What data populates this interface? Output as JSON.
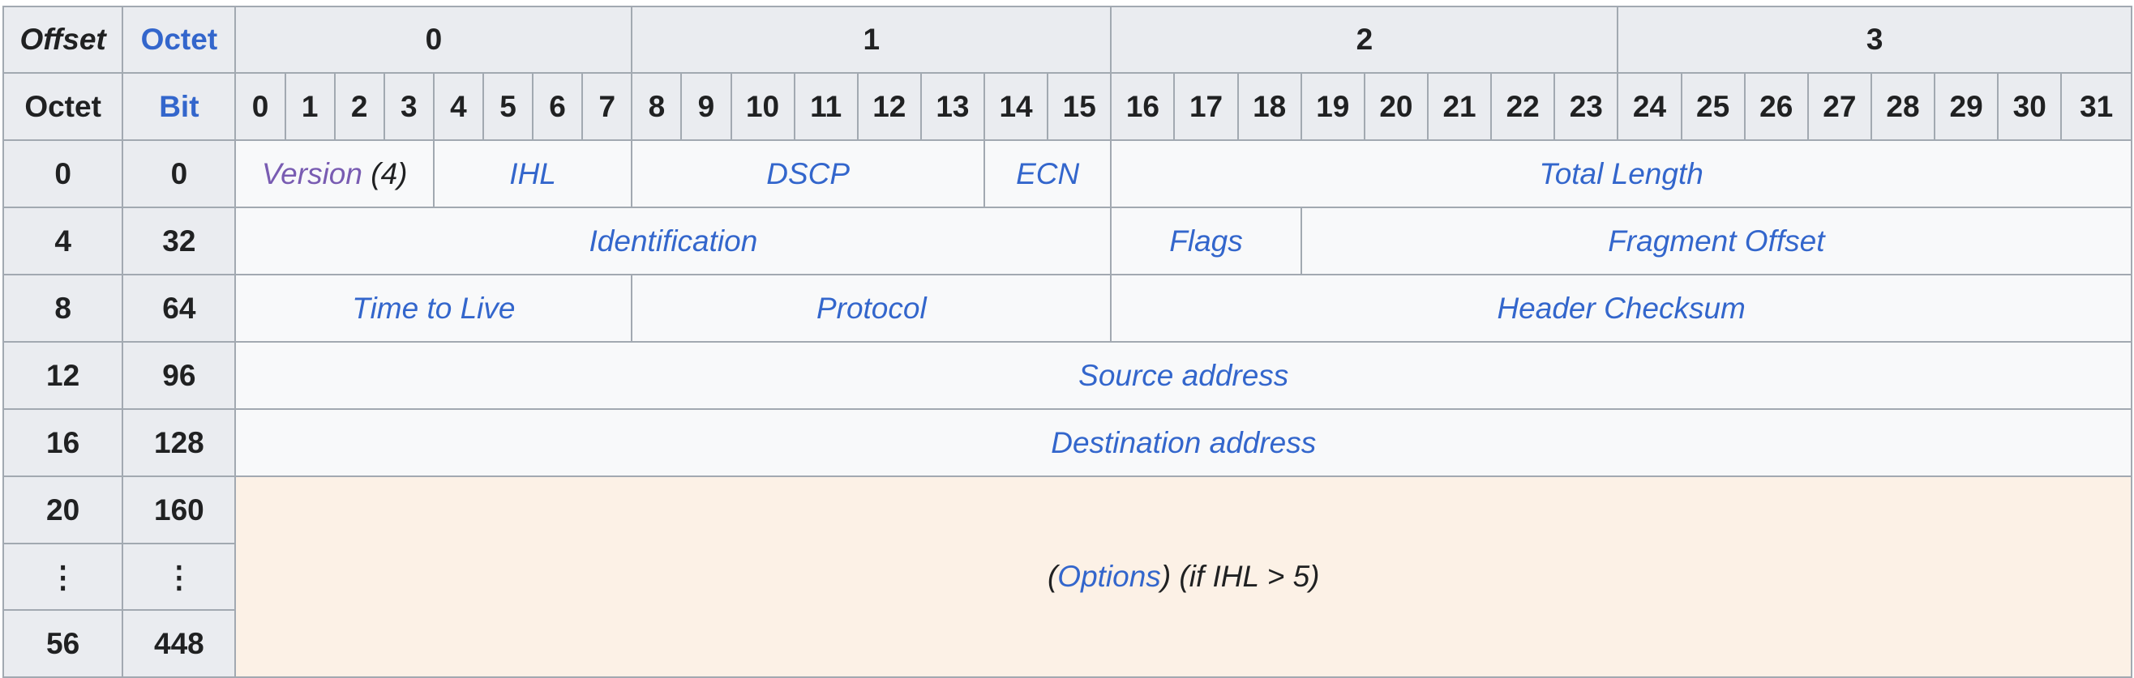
{
  "header": {
    "offset_label": "Offset",
    "octet_label": "Octet",
    "octet_row_label": "Octet",
    "bit_label": "Bit",
    "octet_groups": [
      "0",
      "1",
      "2",
      "3"
    ],
    "bits": [
      "0",
      "1",
      "2",
      "3",
      "4",
      "5",
      "6",
      "7",
      "8",
      "9",
      "10",
      "11",
      "12",
      "13",
      "14",
      "15",
      "16",
      "17",
      "18",
      "19",
      "20",
      "21",
      "22",
      "23",
      "24",
      "25",
      "26",
      "27",
      "28",
      "29",
      "30",
      "31"
    ]
  },
  "rows": [
    {
      "octet": "0",
      "bit": "0"
    },
    {
      "octet": "4",
      "bit": "32"
    },
    {
      "octet": "8",
      "bit": "64"
    },
    {
      "octet": "12",
      "bit": "96"
    },
    {
      "octet": "16",
      "bit": "128"
    },
    {
      "octet": "20",
      "bit": "160"
    },
    {
      "octet": "⋮",
      "bit": "⋮"
    },
    {
      "octet": "56",
      "bit": "448"
    }
  ],
  "fields": {
    "version": "Version",
    "version_suffix": " (4)",
    "ihl": "IHL",
    "dscp": "DSCP",
    "ecn": "ECN",
    "total_length": "Total Length",
    "identification": "Identification",
    "flags": "Flags",
    "fragment_offset": "Fragment Offset",
    "ttl": "Time to Live",
    "protocol": "Protocol",
    "header_checksum": "Header Checksum",
    "source_address": "Source address",
    "destination_address": "Destination address",
    "options_open": "(",
    "options_link": "Options",
    "options_rest": ") (if IHL > 5)"
  },
  "colors": {
    "header_bg": "#eaecf0",
    "field_bg": "#f8f9fa",
    "options_bg": "#fcf1e6",
    "link": "#3366cc",
    "visited_link": "#795cb2",
    "border": "#a2a9b1"
  }
}
